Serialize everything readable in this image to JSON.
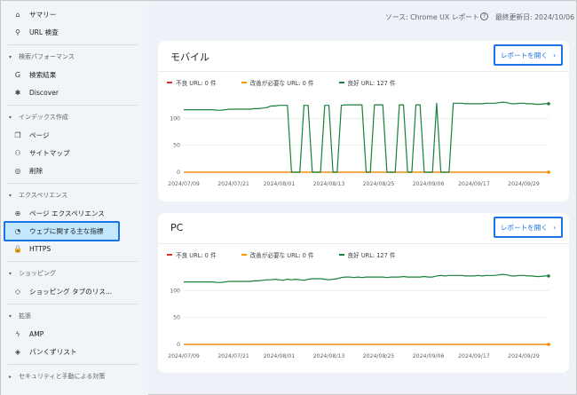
{
  "sidebar": {
    "items": [
      {
        "label": "サマリー",
        "icon": "home-icon",
        "glyph": "⌂"
      },
      {
        "label": "URL 検査",
        "icon": "search-icon",
        "glyph": "⚲"
      }
    ],
    "sections": [
      {
        "title": "検索パフォーマンス",
        "items": [
          {
            "label": "検索結果",
            "icon": "google-g-icon",
            "glyph": "G"
          },
          {
            "label": "Discover",
            "icon": "asterisk-icon",
            "glyph": "✱"
          }
        ]
      },
      {
        "title": "インデックス作成",
        "items": [
          {
            "label": "ページ",
            "icon": "pages-icon",
            "glyph": "❐"
          },
          {
            "label": "サイトマップ",
            "icon": "sitemap-icon",
            "glyph": "⚇"
          },
          {
            "label": "削除",
            "icon": "hidden-eye-icon",
            "glyph": "◎"
          }
        ]
      },
      {
        "title": "エクスペリエンス",
        "items": [
          {
            "label": "ページ エクスペリエンス",
            "icon": "plus-circle-icon",
            "glyph": "⊕"
          },
          {
            "label": "ウェブに関する主な指標",
            "icon": "gauge-icon",
            "glyph": "◔",
            "active": true
          },
          {
            "label": "HTTPS",
            "icon": "lock-icon",
            "glyph": "🔒"
          }
        ]
      },
      {
        "title": "ショッピング",
        "items": [
          {
            "label": "ショッピング タブのリス...",
            "icon": "tag-icon",
            "glyph": "◇"
          }
        ]
      },
      {
        "title": "拡張",
        "items": [
          {
            "label": "AMP",
            "icon": "bolt-icon",
            "glyph": "ϟ"
          },
          {
            "label": "パンくずリスト",
            "icon": "layers-icon",
            "glyph": "◈"
          }
        ]
      },
      {
        "title": "セキュリティと手動による対策",
        "items": []
      }
    ]
  },
  "topbar": {
    "source": "ソース: Chrome UX レポート",
    "help_icon": "help-circle-icon",
    "updated": "最終更新日: 2024/10/06"
  },
  "colors": {
    "poor": "#d93025",
    "needs_improvement": "#f29900",
    "good": "#188038",
    "accent": "#1a73e8"
  },
  "cards": [
    {
      "title": "モバイル",
      "button": "レポートを開く",
      "legend": [
        "不良 URL: 0 件",
        "改善が必要な URL: 0 件",
        "良好 URL: 127 件"
      ]
    },
    {
      "title": "PC",
      "button": "レポートを開く",
      "legend": [
        "不良 URL: 0 件",
        "改善が必要な URL: 0 件",
        "良好 URL: 127 件"
      ]
    }
  ],
  "chart_data": [
    {
      "type": "line",
      "title": "モバイル",
      "x_ticks": [
        "2024/07/09",
        "2024/07/21",
        "2024/08/01",
        "2024/08/13",
        "2024/08/25",
        "2024/09/06",
        "2024/09/17",
        "2024/09/29"
      ],
      "y_ticks": [
        0,
        50,
        100
      ],
      "ylim": [
        0,
        145
      ],
      "start": "2024/07/09",
      "end": "2024/10/05",
      "series": [
        {
          "name": "良好 URL",
          "color": "#188038",
          "values": [
            116,
            116,
            116,
            116,
            116,
            116,
            116,
            116,
            115,
            115,
            116,
            117,
            117,
            117,
            117,
            117,
            117,
            118,
            118,
            119,
            120,
            123,
            123,
            124,
            124,
            124,
            0,
            0,
            0,
            124,
            124,
            0,
            0,
            0,
            124,
            124,
            0,
            0,
            124,
            125,
            125,
            125,
            125,
            125,
            0,
            0,
            125,
            125,
            125,
            0,
            0,
            0,
            125,
            125,
            0,
            0,
            125,
            125,
            0,
            0,
            0,
            128,
            0,
            0,
            0,
            128,
            128,
            128,
            127,
            127,
            127,
            127,
            127,
            128,
            128,
            128,
            129,
            130,
            129,
            127,
            127,
            128,
            128,
            127,
            127,
            126,
            126,
            127,
            127
          ]
        },
        {
          "name": "改善が必要な URL",
          "color": "#f29900",
          "values": [
            0,
            0
          ]
        },
        {
          "name": "不良 URL",
          "color": "#d93025",
          "values": [
            0,
            0
          ]
        }
      ]
    },
    {
      "type": "line",
      "title": "PC",
      "x_ticks": [
        "2024/07/09",
        "2024/07/21",
        "2024/08/01",
        "2024/08/13",
        "2024/08/25",
        "2024/09/06",
        "2024/09/17",
        "2024/09/29"
      ],
      "y_ticks": [
        0,
        50,
        100
      ],
      "ylim": [
        0,
        145
      ],
      "start": "2024/07/09",
      "end": "2024/10/05",
      "series": [
        {
          "name": "良好 URL",
          "color": "#188038",
          "values": [
            116,
            116,
            116,
            116,
            116,
            116,
            116,
            116,
            115,
            115,
            116,
            117,
            117,
            117,
            117,
            117,
            117,
            118,
            118,
            119,
            120,
            120,
            121,
            120,
            119,
            121,
            120,
            121,
            120,
            119,
            121,
            122,
            122,
            122,
            121,
            120,
            121,
            122,
            124,
            125,
            125,
            124,
            125,
            124,
            125,
            125,
            125,
            125,
            125,
            124,
            125,
            125,
            125,
            126,
            125,
            125,
            125,
            125,
            126,
            125,
            125,
            127,
            128,
            127,
            128,
            128,
            128,
            128,
            127,
            127,
            127,
            128,
            127,
            128,
            128,
            128,
            129,
            130,
            129,
            127,
            127,
            128,
            128,
            127,
            127,
            126,
            126,
            127,
            127
          ]
        },
        {
          "name": "改善が必要な URL",
          "color": "#f29900",
          "values": [
            0,
            0
          ]
        },
        {
          "name": "不良 URL",
          "color": "#d93025",
          "values": [
            0,
            0
          ]
        }
      ]
    }
  ]
}
